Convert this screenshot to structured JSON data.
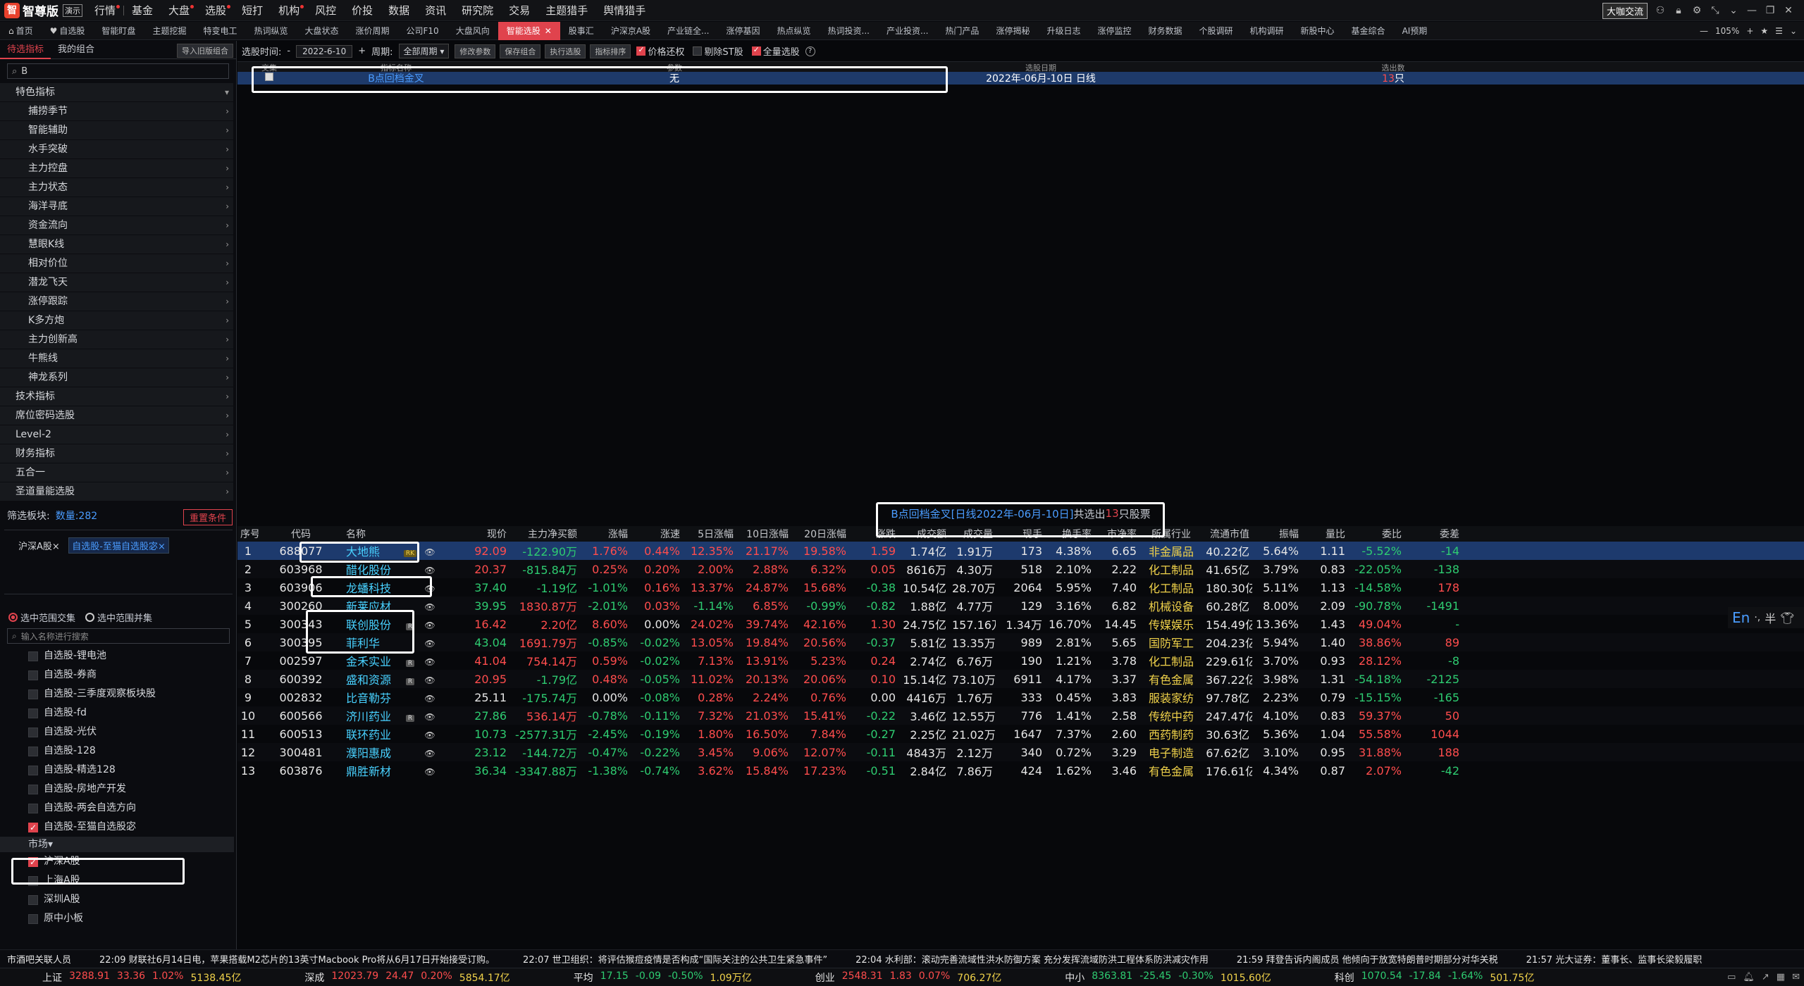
{
  "app": {
    "brand": "智尊版",
    "edition": "演示"
  },
  "menu": [
    {
      "label": "行情",
      "dot": true
    },
    {
      "label": "基金",
      "dot": false
    },
    {
      "label": "大盘",
      "dot": true
    },
    {
      "label": "选股",
      "dot": true
    },
    {
      "label": "短打",
      "dot": false
    },
    {
      "label": "机构",
      "dot": true
    },
    {
      "label": "风控",
      "dot": false
    },
    {
      "label": "价投",
      "dot": false
    },
    {
      "label": "数据",
      "dot": false
    },
    {
      "label": "资讯",
      "dot": false
    },
    {
      "label": "研究院",
      "dot": false
    },
    {
      "label": "交易",
      "dot": false
    },
    {
      "label": "主题猎手",
      "dot": false
    },
    {
      "label": "舆情猎手",
      "dot": false
    }
  ],
  "topright": {
    "button": "大咖交流"
  },
  "tabs": [
    {
      "label": "首页",
      "icon": "home-icon"
    },
    {
      "label": "自选股",
      "icon": "heart-icon"
    },
    {
      "label": "智能盯盘"
    },
    {
      "label": "主题挖掘"
    },
    {
      "label": "特变电工"
    },
    {
      "label": "热词纵览"
    },
    {
      "label": "大盘状态"
    },
    {
      "label": "涨价周期"
    },
    {
      "label": "公司F10"
    },
    {
      "label": "大盘风向"
    },
    {
      "label": "智能选股",
      "active": true
    },
    {
      "label": "股事汇"
    },
    {
      "label": "沪深京A股"
    },
    {
      "label": "产业链全..."
    },
    {
      "label": "涨停基因"
    },
    {
      "label": "热点纵览"
    },
    {
      "label": "热词投资..."
    },
    {
      "label": "产业投资..."
    },
    {
      "label": "热门产品"
    },
    {
      "label": "涨停揭秘"
    },
    {
      "label": "升级日志"
    },
    {
      "label": "涨停监控"
    },
    {
      "label": "财务数据"
    },
    {
      "label": "个股调研"
    },
    {
      "label": "机构调研"
    },
    {
      "label": "新股中心"
    },
    {
      "label": "基金综合"
    },
    {
      "label": "AI预期"
    }
  ],
  "zoom": "105%",
  "left": {
    "tabs": [
      "待选指标",
      "我的组合"
    ],
    "import_label": "导入旧版组合",
    "search_value": "B",
    "special": "特色指标",
    "sub_items": [
      "捕捞季节",
      "智能辅助",
      "水手突破",
      "主力控盘",
      "主力状态",
      "海洋寻底",
      "资金流向",
      "慧眼K线",
      "相对价位",
      "潜龙飞天",
      "涨停跟踪",
      "K多方炮",
      "主力创新高",
      "牛熊线",
      "神龙系列"
    ],
    "cats": [
      "技术指标",
      "席位密码选股",
      "Level-2",
      "财务指标",
      "五合一",
      "圣道量能选股"
    ],
    "filter_label": "筛选板块:",
    "filter_count": "数量:282",
    "reset": "重置条件",
    "chip1": "沪深A股×",
    "chip2": "自选股-至猫自选股宓×",
    "radio1": "选中范围交集",
    "radio2": "选中范围并集",
    "fsearch_placeholder": "输入名称进行搜索",
    "fitems": [
      "自选股-锂电池",
      "自选股-券商",
      "自选股-三季度观察板块股",
      "自选股-fd",
      "自选股-光伏",
      "自选股-128",
      "自选股-精选128",
      "自选股-房地产开发",
      "自选股-两会自选方向",
      "自选股-至猫自选股宓"
    ],
    "market_label": "市场",
    "market_items": [
      {
        "label": "沪深A股",
        "on": true
      },
      {
        "label": "上海A股",
        "on": false
      },
      {
        "label": "深圳A股",
        "on": false
      },
      {
        "label": "原中小板",
        "on": false
      }
    ]
  },
  "toolbar": {
    "label": "选股时间:",
    "dash": "-",
    "date": "2022-6-10",
    "plus": "+",
    "period_label": "周期:",
    "period": "全部周期",
    "btns": [
      "修改参数",
      "保存组合",
      "执行选股",
      "指标排序"
    ],
    "checks": [
      {
        "label": "价格还权",
        "on": true
      },
      {
        "label": "剔除ST股",
        "on": false
      },
      {
        "label": "全量选股",
        "on": true
      }
    ]
  },
  "upper": {
    "headers": [
      "交集",
      "指标名称",
      "参数",
      "选股日期",
      "选出数"
    ],
    "row": {
      "name": "B点回档金叉",
      "param": "无",
      "date": "2022年-06月-10日 日线",
      "count_num": "13",
      "count_unit": "只"
    }
  },
  "result": {
    "title_blue": "B点回档金叉[日线2022年-06月-10日]",
    "mid": " 共选出",
    "num": "13",
    "end": "只股票"
  },
  "columns": [
    "序号",
    "代码",
    "名称",
    "",
    "",
    "现价",
    "主力净买额",
    "涨幅",
    "涨速",
    "5日涨幅",
    "10日涨幅",
    "20日涨幅",
    "涨跌",
    "成交额",
    "成交量",
    "现手",
    "换手率",
    "市净率",
    "所属行业",
    "流通市值",
    "振幅",
    "量比",
    "委比",
    "委差"
  ],
  "rows": [
    [
      "1",
      "688077",
      "大地熊",
      "RK",
      "eye",
      "92.09",
      "-122.90万",
      "1.76%",
      "0.44%",
      "12.35%",
      "21.17%",
      "19.58%",
      "1.59",
      "1.74亿",
      "1.91万",
      "173",
      "4.38%",
      "6.65",
      "非金属品",
      "40.22亿",
      "5.64%",
      "1.11",
      "-5.52%",
      "-14"
    ],
    [
      "2",
      "603968",
      "醋化股份",
      "",
      "eye",
      "20.37",
      "-815.84万",
      "0.25%",
      "0.20%",
      "2.00%",
      "2.88%",
      "6.32%",
      "0.05",
      "8616万",
      "4.30万",
      "518",
      "2.10%",
      "2.22",
      "化工制品",
      "41.65亿",
      "3.79%",
      "0.83",
      "-22.05%",
      "-138"
    ],
    [
      "3",
      "603906",
      "龙蟠科技",
      "",
      "eye",
      "37.40",
      "-1.19亿",
      "-1.01%",
      "0.16%",
      "13.37%",
      "24.87%",
      "15.68%",
      "-0.38",
      "10.54亿",
      "28.70万",
      "2064",
      "5.95%",
      "7.40",
      "化工制品",
      "180.30亿",
      "5.11%",
      "1.13",
      "-14.58%",
      "178"
    ],
    [
      "4",
      "300260",
      "新莱应材",
      "",
      "eye",
      "39.95",
      "1830.87万",
      "-2.01%",
      "0.03%",
      "-1.14%",
      "6.85%",
      "-0.99%",
      "-0.82",
      "1.88亿",
      "4.77万",
      "129",
      "3.16%",
      "6.82",
      "机械设备",
      "60.28亿",
      "8.00%",
      "2.09",
      "-90.78%",
      "-1491"
    ],
    [
      "5",
      "300343",
      "联创股份",
      "R",
      "eye",
      "16.42",
      "2.20亿",
      "8.60%",
      "0.00%",
      "24.02%",
      "39.74%",
      "42.16%",
      "1.30",
      "24.75亿",
      "157.16万",
      "1.34万",
      "16.70%",
      "14.45",
      "传媒娱乐",
      "154.49亿",
      "13.36%",
      "1.43",
      "49.04%",
      "-"
    ],
    [
      "6",
      "300395",
      "菲利华",
      "",
      "eye",
      "43.04",
      "1691.79万",
      "-0.85%",
      "-0.02%",
      "13.05%",
      "19.84%",
      "20.56%",
      "-0.37",
      "5.81亿",
      "13.35万",
      "989",
      "2.81%",
      "5.65",
      "国防军工",
      "204.23亿",
      "5.94%",
      "1.40",
      "38.86%",
      "89"
    ],
    [
      "7",
      "002597",
      "金禾实业",
      "R",
      "eye",
      "41.04",
      "754.14万",
      "0.59%",
      "-0.02%",
      "7.13%",
      "13.91%",
      "5.23%",
      "0.24",
      "2.74亿",
      "6.76万",
      "190",
      "1.21%",
      "3.78",
      "化工制品",
      "229.61亿",
      "3.70%",
      "0.93",
      "28.12%",
      "-8"
    ],
    [
      "8",
      "600392",
      "盛和资源",
      "R",
      "eye",
      "20.95",
      "-1.79亿",
      "0.48%",
      "-0.05%",
      "11.02%",
      "20.13%",
      "20.06%",
      "0.10",
      "15.14亿",
      "73.10万",
      "6911",
      "4.17%",
      "3.37",
      "有色金属",
      "367.22亿",
      "3.98%",
      "1.31",
      "-54.18%",
      "-2125"
    ],
    [
      "9",
      "002832",
      "比音勒芬",
      "",
      "eye",
      "25.11",
      "-175.74万",
      "0.00%",
      "-0.08%",
      "0.28%",
      "2.24%",
      "0.76%",
      "0.00",
      "4416万",
      "1.76万",
      "333",
      "0.45%",
      "3.83",
      "服装家纺",
      "97.78亿",
      "2.23%",
      "0.79",
      "-15.15%",
      "-165"
    ],
    [
      "10",
      "600566",
      "济川药业",
      "R",
      "eye",
      "27.86",
      "536.14万",
      "-0.78%",
      "-0.11%",
      "7.32%",
      "21.03%",
      "15.41%",
      "-0.22",
      "3.46亿",
      "12.55万",
      "776",
      "1.41%",
      "2.58",
      "传统中药",
      "247.47亿",
      "4.10%",
      "0.83",
      "59.37%",
      "50"
    ],
    [
      "11",
      "600513",
      "联环药业",
      "",
      "eye",
      "10.73",
      "-2577.31万",
      "-2.45%",
      "-0.19%",
      "1.80%",
      "16.50%",
      "7.84%",
      "-0.27",
      "2.25亿",
      "21.02万",
      "1647",
      "7.37%",
      "2.60",
      "西药制药",
      "30.63亿",
      "5.36%",
      "1.04",
      "55.58%",
      "1044"
    ],
    [
      "12",
      "300481",
      "濮阳惠成",
      "",
      "eye",
      "23.12",
      "-144.72万",
      "-0.47%",
      "-0.22%",
      "3.45%",
      "9.06%",
      "12.07%",
      "-0.11",
      "4843万",
      "2.12万",
      "340",
      "0.72%",
      "3.29",
      "电子制造",
      "67.62亿",
      "3.10%",
      "0.95",
      "31.88%",
      "188"
    ],
    [
      "13",
      "603876",
      "鼎胜新材",
      "",
      "eye",
      "36.34",
      "-3347.88万",
      "-1.38%",
      "-0.74%",
      "3.62%",
      "15.84%",
      "17.23%",
      "-0.51",
      "2.84亿",
      "7.86万",
      "424",
      "1.62%",
      "3.46",
      "有色金属",
      "176.61亿",
      "4.34%",
      "0.87",
      "2.07%",
      "-42"
    ]
  ],
  "ticker": [
    "市酒吧关联人员",
    "22:09 财联社6月14日电，苹果搭载M2芯片的13英寸Macbook Pro将从6月17日开始接受订购。",
    "22:07 世卫组织：将评估猴痘疫情是否构成“国际关注的公共卫生紧急事件”",
    "22:04 水利部：滚动完善流域性洪水防御方案 充分发挥流域防洪工程体系防洪减灾作用",
    "21:59 拜登告诉内阁成员 他倾向于放宽特朗普时期部分对华关税",
    "21:57 光大证券：董事长、监事长梁毅履职"
  ],
  "indices": [
    {
      "name": "上证",
      "v": "3288.91",
      "c": "33.36",
      "p": "1.02%",
      "a": "5138.45亿",
      "dir": "up"
    },
    {
      "name": "深成",
      "v": "12023.79",
      "c": "24.47",
      "p": "0.20%",
      "a": "5854.17亿",
      "dir": "up"
    },
    {
      "name": "平均",
      "v": "17.15",
      "c": "-0.09",
      "p": "-0.50%",
      "a": "1.09万亿",
      "dir": "dn"
    },
    {
      "name": "创业",
      "v": "2548.31",
      "c": "1.83",
      "p": "0.07%",
      "a": "706.27亿",
      "dir": "up"
    },
    {
      "name": "中小",
      "v": "8363.81",
      "c": "-25.45",
      "p": "-0.30%",
      "a": "1015.60亿",
      "dir": "dn"
    },
    {
      "name": "科创",
      "v": "1070.54",
      "c": "-17.84",
      "p": "-1.64%",
      "a": "501.75亿",
      "dir": "dn"
    }
  ],
  "ime": {
    "lang": "En"
  },
  "colors": {
    "up": "#ff4d4d",
    "down": "#2ecc71",
    "accent": "#e0434d",
    "link": "#4a9cff",
    "selected_row": "#1d3a6d"
  }
}
